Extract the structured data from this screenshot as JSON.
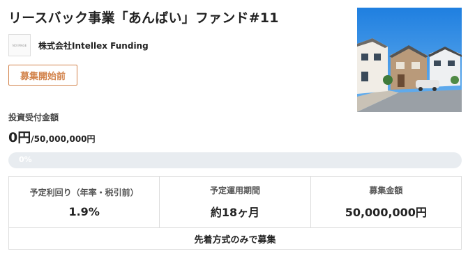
{
  "fund": {
    "title": "リースバック事業「あんばい」ファンド#11",
    "company_logo_text": "NO IMAGE",
    "company_name": "株式会社Intellex Funding",
    "status_badge": "募集開始前",
    "photo_icon": "house-photo"
  },
  "investment": {
    "label": "投資受付金額",
    "amount": "0円",
    "target": "/50,000,000円",
    "progress_text": "0%",
    "progress_fraction": 0,
    "colors": {
      "track": "#e8ecf0",
      "fill": "#9ec8ea",
      "accent": "#d2824a"
    }
  },
  "details": {
    "cells": [
      {
        "label": "予定利回り（年率・税引前）",
        "value": "1.9%"
      },
      {
        "label": "予定運用期間",
        "value": "約18ヶ月"
      },
      {
        "label": "募集金額",
        "value": "50,000,000円"
      }
    ],
    "note": "先着方式のみで募集"
  }
}
